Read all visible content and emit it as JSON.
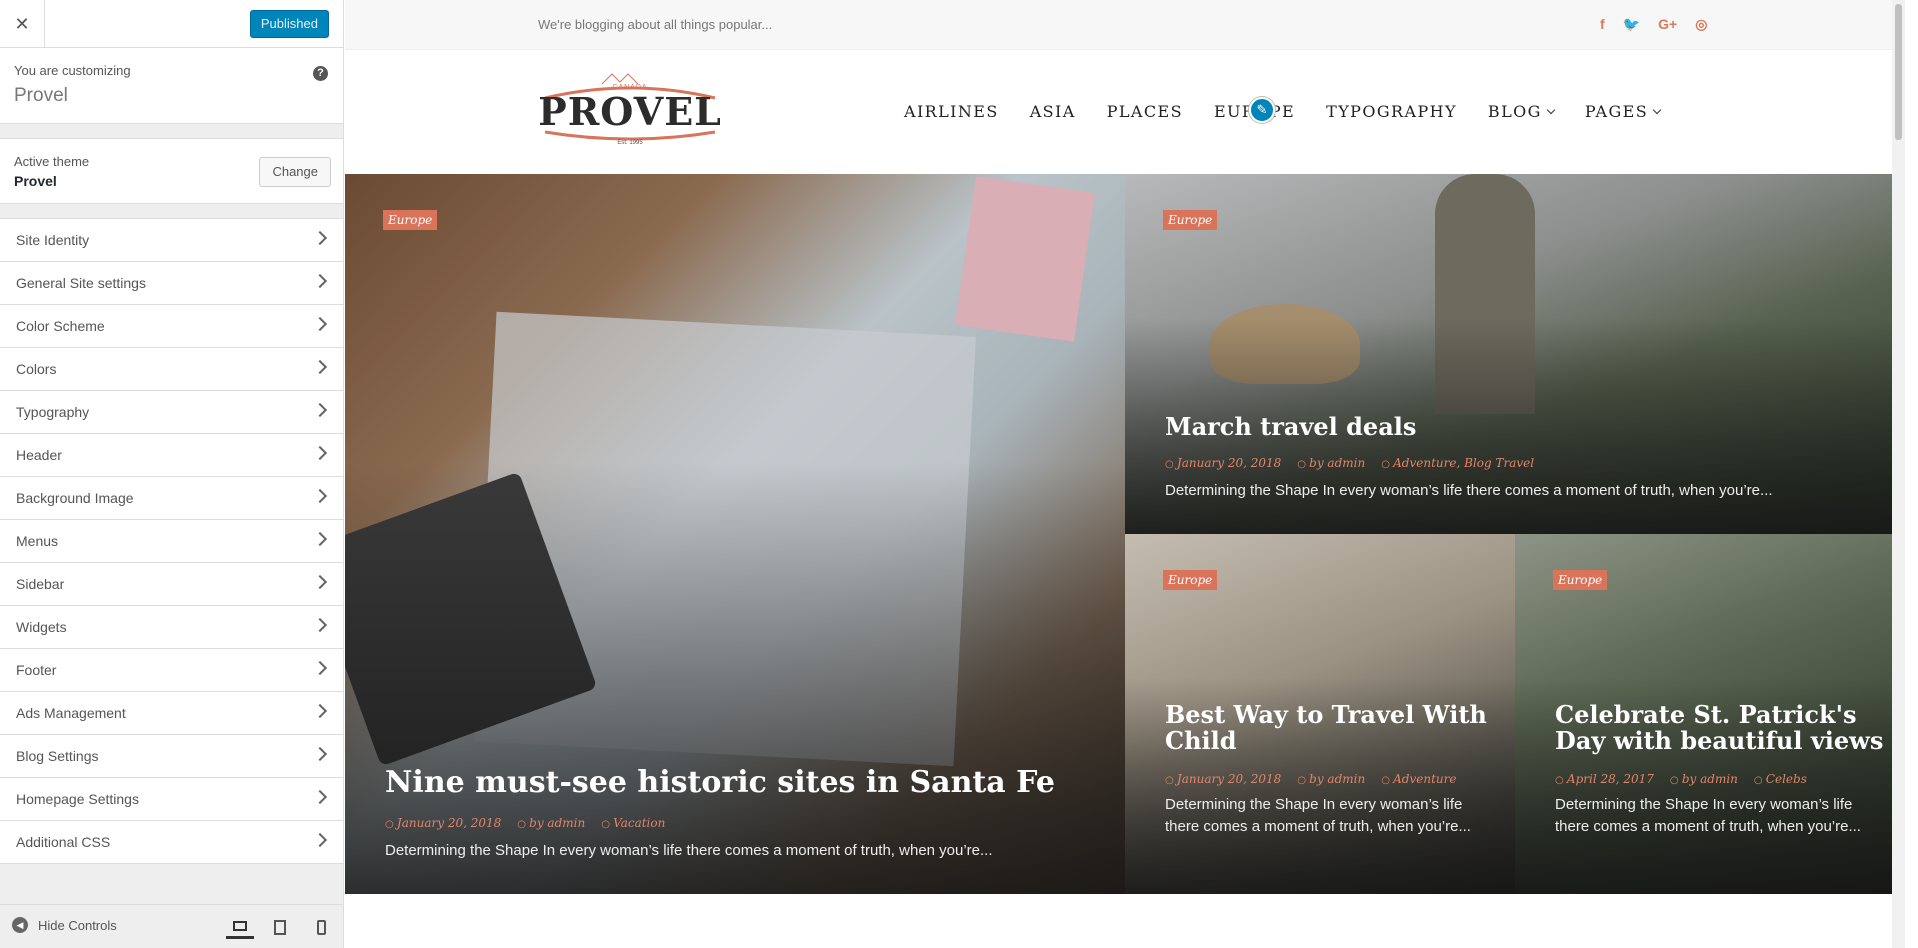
{
  "customizer": {
    "close_label": "✕",
    "publish_label": "Published",
    "customizing_label": "You are customizing",
    "site_name": "Provel",
    "help_label": "?",
    "active_theme_label": "Active theme",
    "active_theme_name": "Provel",
    "change_label": "Change",
    "menu": [
      {
        "label": "Site Identity"
      },
      {
        "label": "General Site settings"
      },
      {
        "label": "Color Scheme"
      },
      {
        "label": "Colors"
      },
      {
        "label": "Typography"
      },
      {
        "label": "Header"
      },
      {
        "label": "Background Image"
      },
      {
        "label": "Menus"
      },
      {
        "label": "Sidebar"
      },
      {
        "label": "Widgets"
      },
      {
        "label": "Footer"
      },
      {
        "label": "Ads Management"
      },
      {
        "label": "Blog Settings"
      },
      {
        "label": "Homepage Settings"
      },
      {
        "label": "Additional CSS"
      }
    ],
    "hide_controls_label": "Hide Controls"
  },
  "site": {
    "tagline": "We're blogging about all things popular...",
    "social_icons": [
      "facebook-icon",
      "twitter-icon",
      "google-plus-icon",
      "instagram-icon"
    ],
    "social_glyphs": [
      "f",
      "🐦",
      "G+",
      "◎"
    ],
    "logo": {
      "top": "CANADA",
      "name": "PROVEL",
      "est": "Est. 1995"
    },
    "nav": [
      {
        "label": "AIRLINES"
      },
      {
        "label": "ASIA"
      },
      {
        "label": "PLACES"
      },
      {
        "label": "EUROPE"
      },
      {
        "label": "TYPOGRAPHY"
      },
      {
        "label": "BLOG"
      },
      {
        "label": "PAGES"
      }
    ],
    "accent_color": "#d9735a"
  },
  "posts": [
    {
      "category": "Europe",
      "title": "Nine must-see historic sites in Santa Fe",
      "date": "January 20, 2018",
      "author": "by admin",
      "tags": "Vacation",
      "excerpt": "Determining the Shape In every woman’s life there comes a moment of truth, when you’re..."
    },
    {
      "category": "Europe",
      "title": "March travel deals",
      "date": "January 20, 2018",
      "author": "by admin",
      "tags": "Adventure, Blog Travel",
      "excerpt": "Determining the Shape In every woman’s life there comes a moment of truth, when you’re..."
    },
    {
      "category": "Europe",
      "title": "Best Way to Travel With Child",
      "date": "January 20, 2018",
      "author": "by admin",
      "tags": "Adventure",
      "excerpt": "Determining the Shape In every woman’s life there comes a moment of truth, when you’re..."
    },
    {
      "category": "Europe",
      "title": "Celebrate St. Patrick's Day with beautiful views",
      "date": "April 28, 2017",
      "author": "by admin",
      "tags": "Celebs",
      "excerpt": "Determining the Shape In every woman’s life there comes a moment of truth, when you’re..."
    }
  ]
}
